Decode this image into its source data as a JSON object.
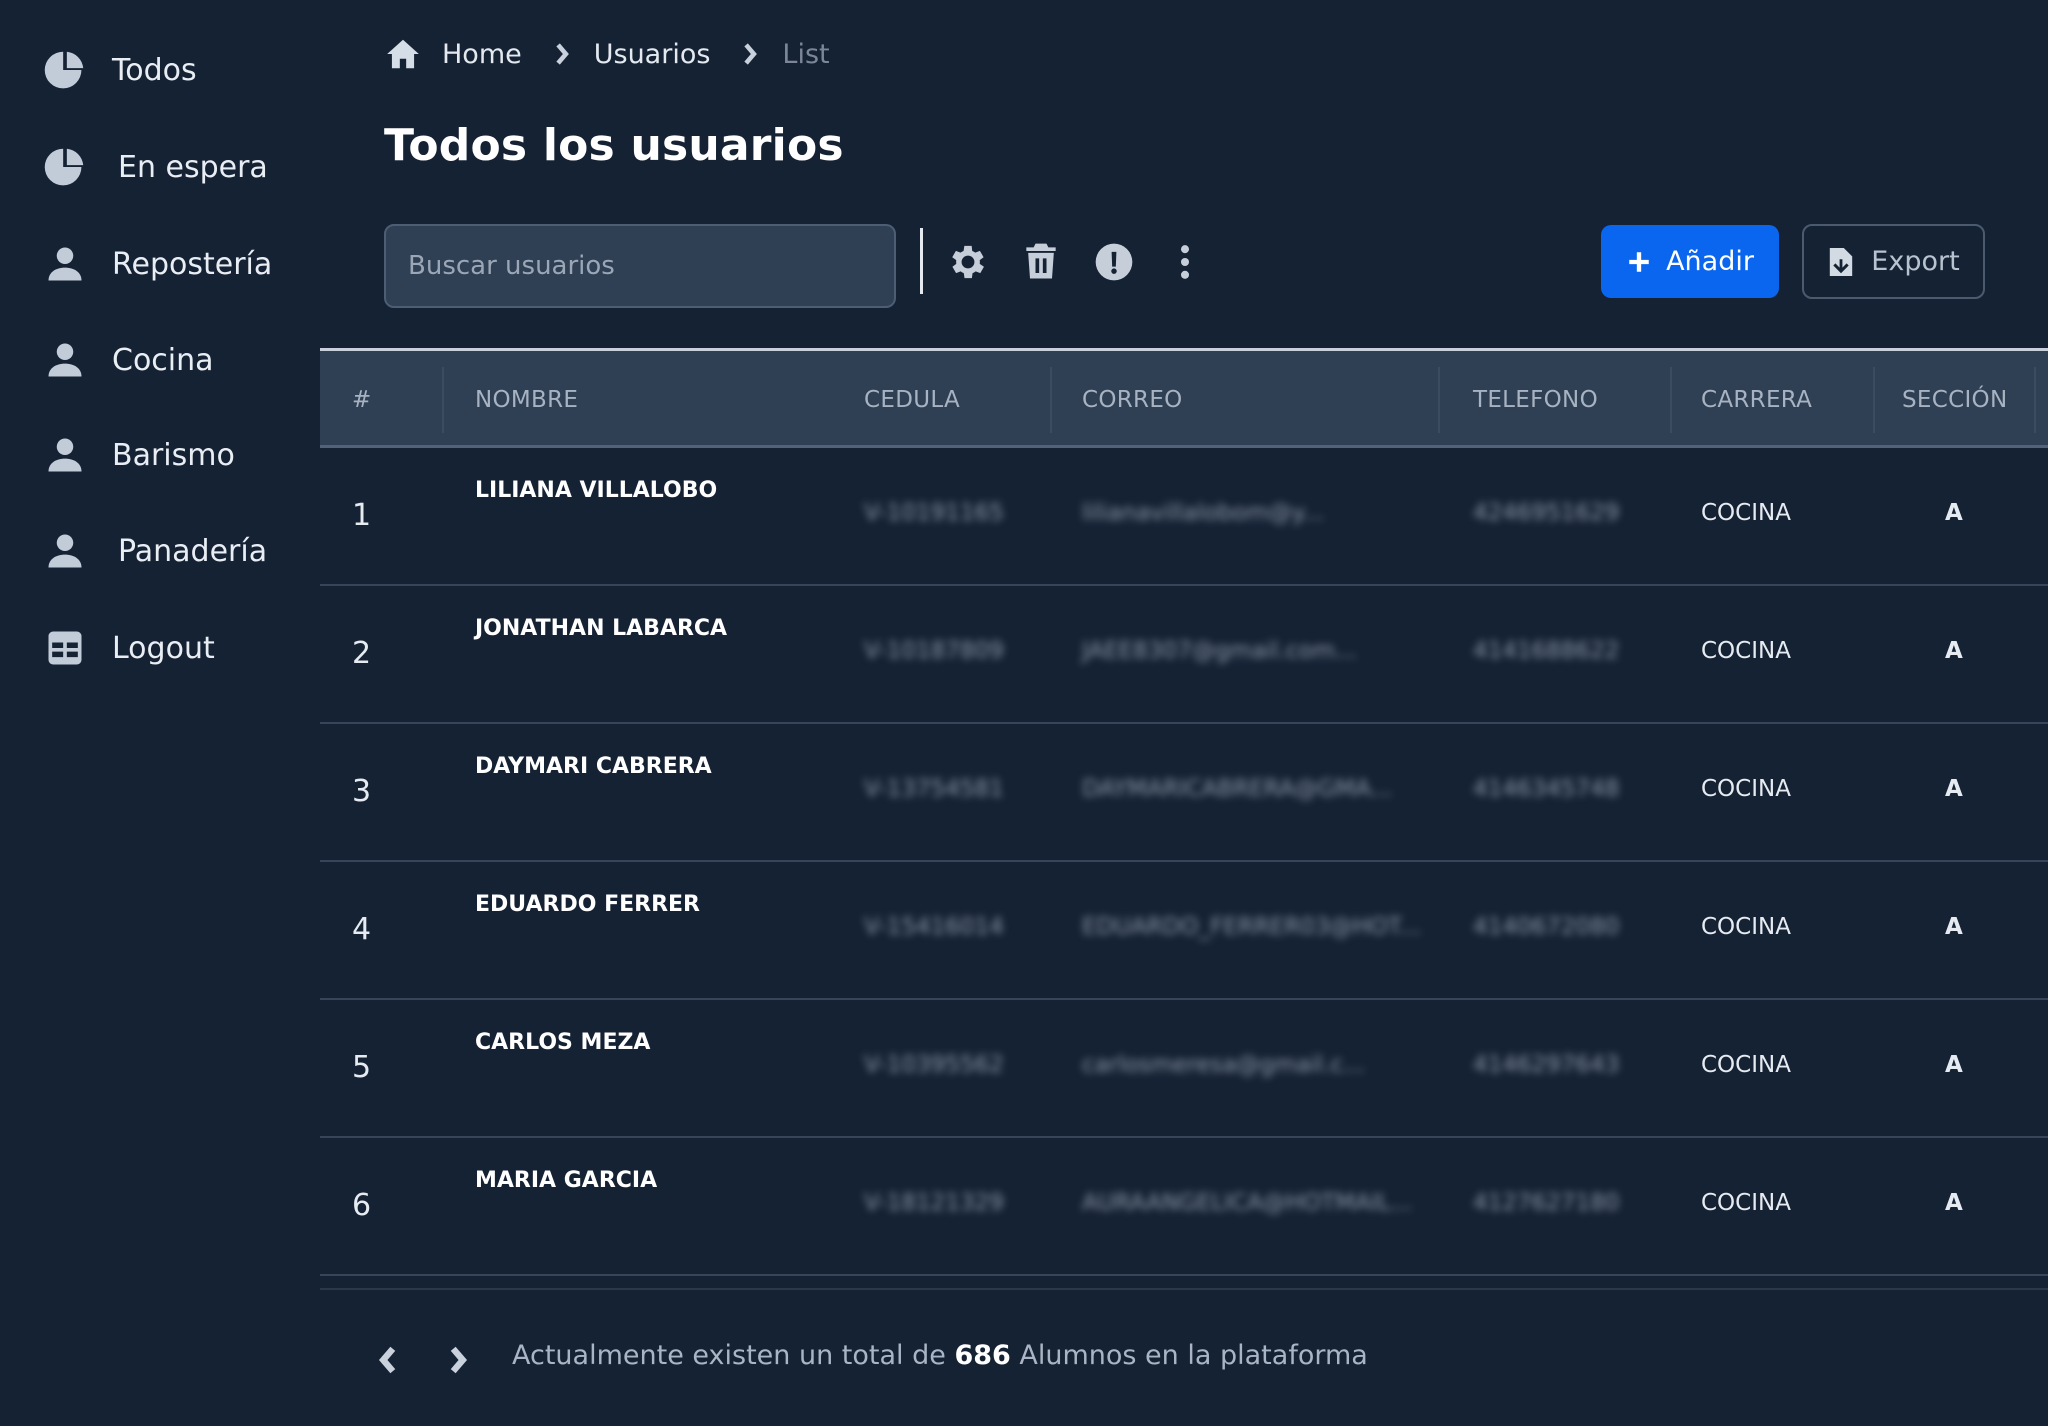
{
  "sidebar": {
    "items": [
      {
        "label": "Todos",
        "icon": "pie-chart-icon"
      },
      {
        "label": "En espera",
        "icon": "pie-chart-icon"
      },
      {
        "label": "Repostería",
        "icon": "user-icon"
      },
      {
        "label": "Cocina",
        "icon": "user-icon"
      },
      {
        "label": "Barismo",
        "icon": "user-icon"
      },
      {
        "label": "Panadería",
        "icon": "user-icon"
      },
      {
        "label": "Logout",
        "icon": "table-icon"
      }
    ]
  },
  "breadcrumb": {
    "home": "Home",
    "usuarios": "Usuarios",
    "current": "List"
  },
  "page": {
    "title": "Todos los usuarios"
  },
  "toolbar": {
    "search_placeholder": "Buscar usuarios",
    "add_label": "Añadir",
    "export_label": "Export"
  },
  "table": {
    "columns": {
      "num": "#",
      "nombre": "NOMBRE",
      "cedula": "CEDULA",
      "correo": "CORREO",
      "telefono": "TELEFONO",
      "carrera": "CARRERA",
      "seccion": "SECCIÓN"
    },
    "rows": [
      {
        "num": "1",
        "nombre": "LILIANA VILLALOBO",
        "cedula": "V-10191165",
        "correo": "lilianavillalobom@y...",
        "telefono": "4246951629",
        "carrera": "COCINA",
        "seccion": "A"
      },
      {
        "num": "2",
        "nombre": "JONATHAN LABARCA",
        "cedula": "V-10187809",
        "correo": "JAEE8307@gmail.com...",
        "telefono": "4141688622",
        "carrera": "COCINA",
        "seccion": "A"
      },
      {
        "num": "3",
        "nombre": "DAYMARI CABRERA",
        "cedula": "V-13754581",
        "correo": "DAYMARICABRERA@GMA...",
        "telefono": "4146345748",
        "carrera": "COCINA",
        "seccion": "A"
      },
      {
        "num": "4",
        "nombre": "EDUARDO FERRER",
        "cedula": "V-15416014",
        "correo": "EDUARDO_FERRER03@HOT...",
        "telefono": "4140672080",
        "carrera": "COCINA",
        "seccion": "A"
      },
      {
        "num": "5",
        "nombre": "CARLOS MEZA",
        "cedula": "V-10395562",
        "correo": "carlosmeresa@gmail.c...",
        "telefono": "4146297643",
        "carrera": "COCINA",
        "seccion": "A"
      },
      {
        "num": "6",
        "nombre": "MARIA GARCIA",
        "cedula": "V-18121329",
        "correo": "AURAANGELICA@HOTMAIL...",
        "telefono": "4127627180",
        "carrera": "COCINA",
        "seccion": "A"
      }
    ]
  },
  "footer": {
    "text_before": "Actualmente existen un total de ",
    "total": "686",
    "text_after": " Alumnos en la plataforma"
  }
}
